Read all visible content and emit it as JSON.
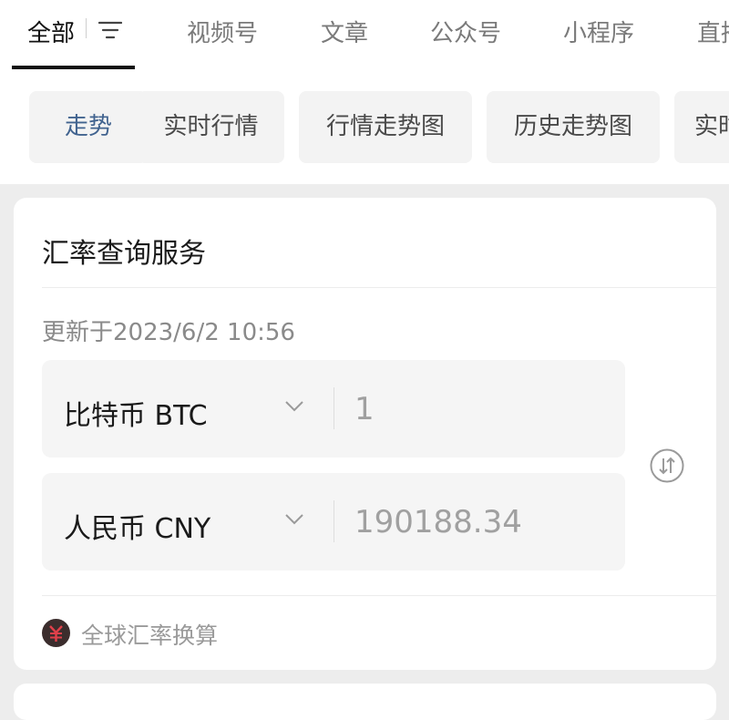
{
  "tabs": {
    "items": [
      "全部",
      "视频号",
      "文章",
      "公众号",
      "小程序",
      "直播"
    ],
    "active_index": 0
  },
  "chips": [
    "走势",
    "实时行情",
    "行情走势图",
    "历史走势图",
    "实时"
  ],
  "card": {
    "title": "汇率查询服务",
    "updated": "更新于2023/6/2 10:56",
    "from": {
      "currency": "比特币 BTC",
      "amount": "1"
    },
    "to": {
      "currency": "人民币 CNY",
      "amount": "190188.34"
    },
    "footer": "全球汇率换算"
  },
  "icons": {
    "filter": "filter-icon",
    "chevron": "chevron-down-icon",
    "swap": "swap-icon",
    "exchange": "exchange-rate-icon"
  },
  "colors": {
    "accent_blue": "#41638f",
    "page_bg": "#ededed"
  }
}
